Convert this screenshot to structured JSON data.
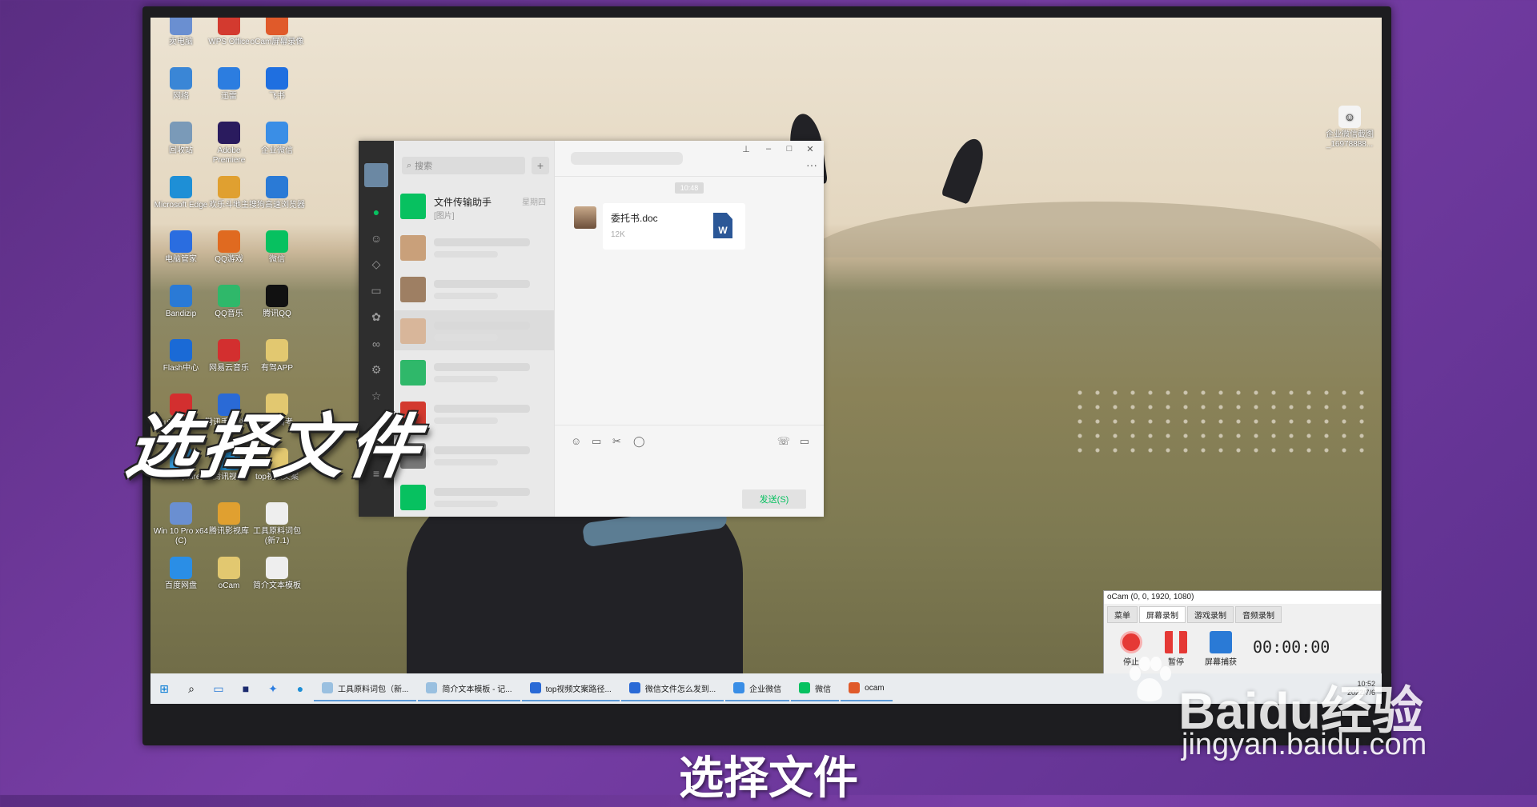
{
  "desktop": {
    "icons": [
      {
        "label": "卖电脑",
        "color": "#6a8fd1"
      },
      {
        "label": "WPS Office",
        "color": "#d33a2f"
      },
      {
        "label": "oCam屏幕录像",
        "color": "#e05a2a"
      },
      {
        "label": "网络",
        "color": "#3a86d6"
      },
      {
        "label": "迅雷",
        "color": "#2c7de0"
      },
      {
        "label": "飞书",
        "color": "#1f6fe0"
      },
      {
        "label": "回收站",
        "color": "#7a9ab8"
      },
      {
        "label": "Adobe Premiere",
        "color": "#2a1b5e"
      },
      {
        "label": "企业微信",
        "color": "#3a8ee6"
      },
      {
        "label": "Microsoft Edge",
        "color": "#1e8fd6"
      },
      {
        "label": "欢乐斗地主",
        "color": "#e0a030"
      },
      {
        "label": "搜狗高速浏览器",
        "color": "#2a7ad6"
      },
      {
        "label": "电脑管家",
        "color": "#2a6de0"
      },
      {
        "label": "QQ游戏",
        "color": "#e06a20"
      },
      {
        "label": "微信",
        "color": "#07c160"
      },
      {
        "label": "Bandizip",
        "color": "#2a7ad6"
      },
      {
        "label": "QQ音乐",
        "color": "#2fb86a"
      },
      {
        "label": "腾讯QQ",
        "color": "#111111"
      },
      {
        "label": "Flash中心",
        "color": "#1a6ad6"
      },
      {
        "label": "网易云音乐",
        "color": "#d32f2f"
      },
      {
        "label": "有驾APP",
        "color": "#e2c870"
      },
      {
        "label": "YouTubeDown",
        "color": "#d32f2f"
      },
      {
        "label": "腾讯手游助手",
        "color": "#2a6ad6"
      },
      {
        "label": "知道高考",
        "color": "#e2c870"
      },
      {
        "label": "EVCapture",
        "color": "#3aa0e0"
      },
      {
        "label": "腾讯视频",
        "color": "#2a9be0"
      },
      {
        "label": "top视频文案",
        "color": "#e2c870"
      },
      {
        "label": "Win 10 Pro x64 (C)",
        "color": "#6a8fd1"
      },
      {
        "label": "腾讯影视库",
        "color": "#e0a030"
      },
      {
        "label": "工具原料词包(新7.1)",
        "color": "#eeeeee"
      },
      {
        "label": "百度网盘",
        "color": "#2a8ee6"
      },
      {
        "label": "oCam",
        "color": "#e2c870"
      },
      {
        "label": "简介文本模板",
        "color": "#eeeeee"
      }
    ],
    "right_icon_label": "企业微信截图_16978888..."
  },
  "wechat": {
    "search_placeholder": "搜索",
    "plus": "+",
    "chats": [
      {
        "name": "文件传输助手",
        "sub": "[图片]",
        "time": "星期四",
        "color": "#07c160"
      }
    ],
    "time_stamp": "10:48",
    "file": {
      "name": "委托书.doc",
      "size": "12K",
      "icon": "W"
    },
    "send_label": "发送(S)",
    "more": "···"
  },
  "ocam": {
    "title": "oCam (0, 0, 1920, 1080)",
    "tabs": [
      "菜单",
      "屏幕录制",
      "游戏录制",
      "音频录制"
    ],
    "buttons": [
      "停止",
      "暂停",
      "屏幕捕获"
    ],
    "timer": "00:00:00"
  },
  "taskbar": {
    "apps": [
      {
        "label": "工具原料词包（新...",
        "color": "#9ac0e0"
      },
      {
        "label": "简介文本模板 - 记...",
        "color": "#9ac0e0"
      },
      {
        "label": "top视频文案路径...",
        "color": "#2a6ad6"
      },
      {
        "label": "微信文件怎么发到...",
        "color": "#2a6ad6"
      },
      {
        "label": "企业微信",
        "color": "#3a8ee6"
      },
      {
        "label": "微信",
        "color": "#07c160"
      },
      {
        "label": "ocam",
        "color": "#e05a2a"
      }
    ],
    "clock": "10:52",
    "date": "2022/7/6"
  },
  "overlay": {
    "caption": "选择文件",
    "subtitle": "选择文件",
    "watermark": "Baidu经验",
    "watermark_url": "jingyan.baidu.com"
  }
}
